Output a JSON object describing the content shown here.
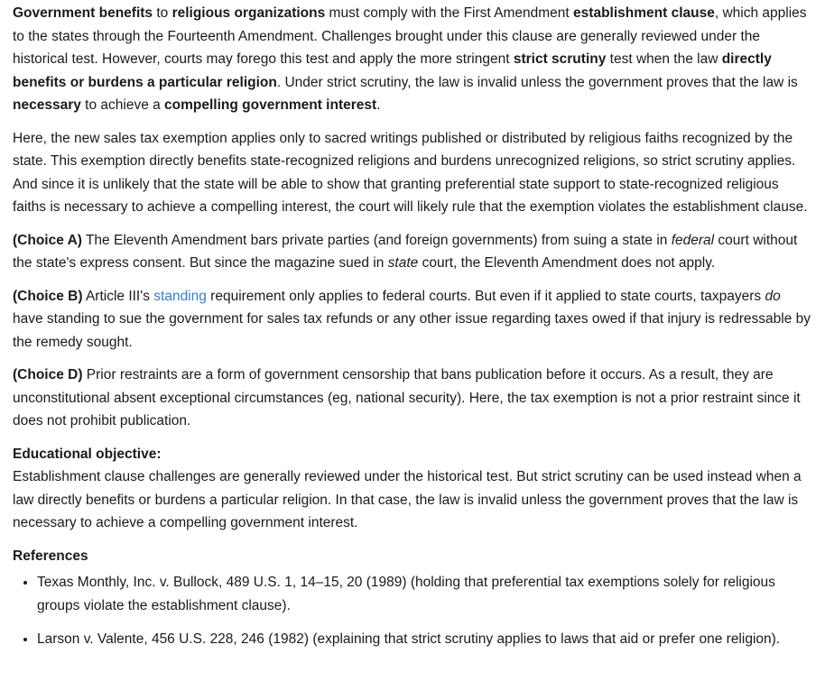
{
  "para1": {
    "s1": "Government benefits",
    "s2": " to ",
    "s3": "religious organizations",
    "s4": " must comply with the First Amendment ",
    "s5": "establishment clause",
    "s6": ", which applies to the states through the Fourteenth Amendment.  Challenges brought under this clause are generally reviewed under the historical test.  However, courts may forego this test and apply the more stringent ",
    "s7": "strict scrutiny",
    "s8": " test when the law ",
    "s9": "directly benefits or burdens a particular religion",
    "s10": ".  Under strict scrutiny, the law is invalid unless the government proves that the law is ",
    "s11": "necessary",
    "s12": " to achieve a ",
    "s13": "compelling government interest",
    "s14": "."
  },
  "para2": "Here, the new sales tax exemption applies only to sacred writings published or distributed by religious faiths recognized by the state.  This exemption directly benefits state-recognized religions and burdens unrecognized religions, so strict scrutiny applies.  And since it is unlikely that the state will be able to show that granting preferential state support to state-recognized religious faiths is necessary to achieve a compelling interest, the court will likely rule that the exemption violates the establishment clause.",
  "choice_a": {
    "label": "(Choice A)",
    "t1": "  The Eleventh Amendment bars private parties (and foreign governments) from suing a state in ",
    "t2": "federal",
    "t3": " court without the state's express consent.  But since the magazine sued in ",
    "t4": "state",
    "t5": " court, the Eleventh Amendment does not apply."
  },
  "choice_b": {
    "label": "(Choice B)",
    "t1": "  Article III's ",
    "link": "standing",
    "t2": " requirement only applies to federal courts.  But even if it applied to state courts, taxpayers ",
    "t3": "do",
    "t4": " have standing to sue the government for sales tax refunds or any other issue regarding taxes owed if that injury is redressable by the remedy sought."
  },
  "choice_d": {
    "label": "(Choice D)",
    "t1": "  Prior restraints are a form of government censorship that bans publication before it occurs.  As a result, they are unconstitutional absent exceptional circumstances (eg, national security).  Here, the tax exemption is not a prior restraint since it does not prohibit publication."
  },
  "objective": {
    "heading": "Educational objective:",
    "text": "Establishment clause challenges are generally reviewed under the historical test.  But strict scrutiny can be used instead when a law directly benefits or burdens a particular religion.  In that case, the law is invalid unless the government proves that the law is necessary to achieve a compelling government interest."
  },
  "references": {
    "heading": "References",
    "items": [
      "Texas Monthly, Inc. v. Bullock, 489 U.S. 1, 14–15, 20 (1989) (holding that preferential tax exemptions solely for religious groups violate the establishment clause).",
      "Larson v. Valente, 456 U.S. 228, 246 (1982) (explaining that strict scrutiny applies to laws that aid or prefer one religion)."
    ]
  }
}
